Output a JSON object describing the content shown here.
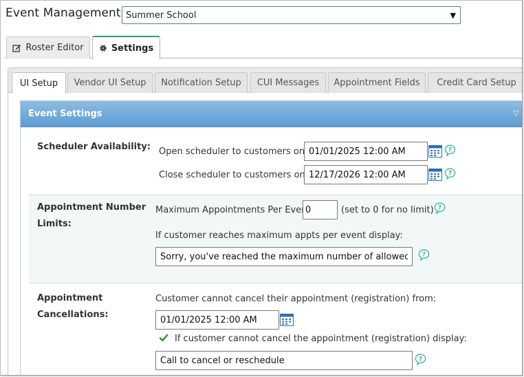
{
  "header": {
    "label": "Event Management:",
    "selected_event": "Summer School"
  },
  "outer_tabs": {
    "roster_label": "Roster Editor",
    "settings_label": "Settings"
  },
  "inner_tabs": [
    "UI Setup",
    "Vendor UI Setup",
    "Notification Setup",
    "CUI Messages",
    "Appointment Fields",
    "Credit Card Setup"
  ],
  "panel": {
    "title": "Event Settings"
  },
  "scheduler": {
    "label": "Scheduler Availability:",
    "open_label": "Open scheduler to customers on:",
    "open_value": "01/01/2025 12:00 AM",
    "close_label": "Close scheduler to customers on:",
    "close_value": "12/17/2026 12:00 AM"
  },
  "limits": {
    "label_line1": "Appointment Number",
    "label_line2": "Limits:",
    "max_label": "Maximum Appointments Per Event:",
    "max_value": "0",
    "max_hint": "(set to 0 for no limit)",
    "display_label": "If customer reaches maximum appts per event display:",
    "display_value": "Sorry, you've reached the maximum number of allowed appointments"
  },
  "cancellations": {
    "label_line1": "Appointment",
    "label_line2": "Cancellations:",
    "from_label": "Customer cannot cancel their appointment (registration) from:",
    "from_value": "01/01/2025 12:00 AM",
    "checkbox_label": "If customer cannot cancel the appointment (registration) display:",
    "checkbox_checked": true,
    "display_value": "Call to cancel or reschedule"
  },
  "colors": {
    "accent_green": "#2c9a6b",
    "panel_header": "#6aa5d8",
    "section_tint": "#f1f8f5",
    "help_icon": "#2fb39c",
    "calendar_icon": "#2f6fb3"
  }
}
